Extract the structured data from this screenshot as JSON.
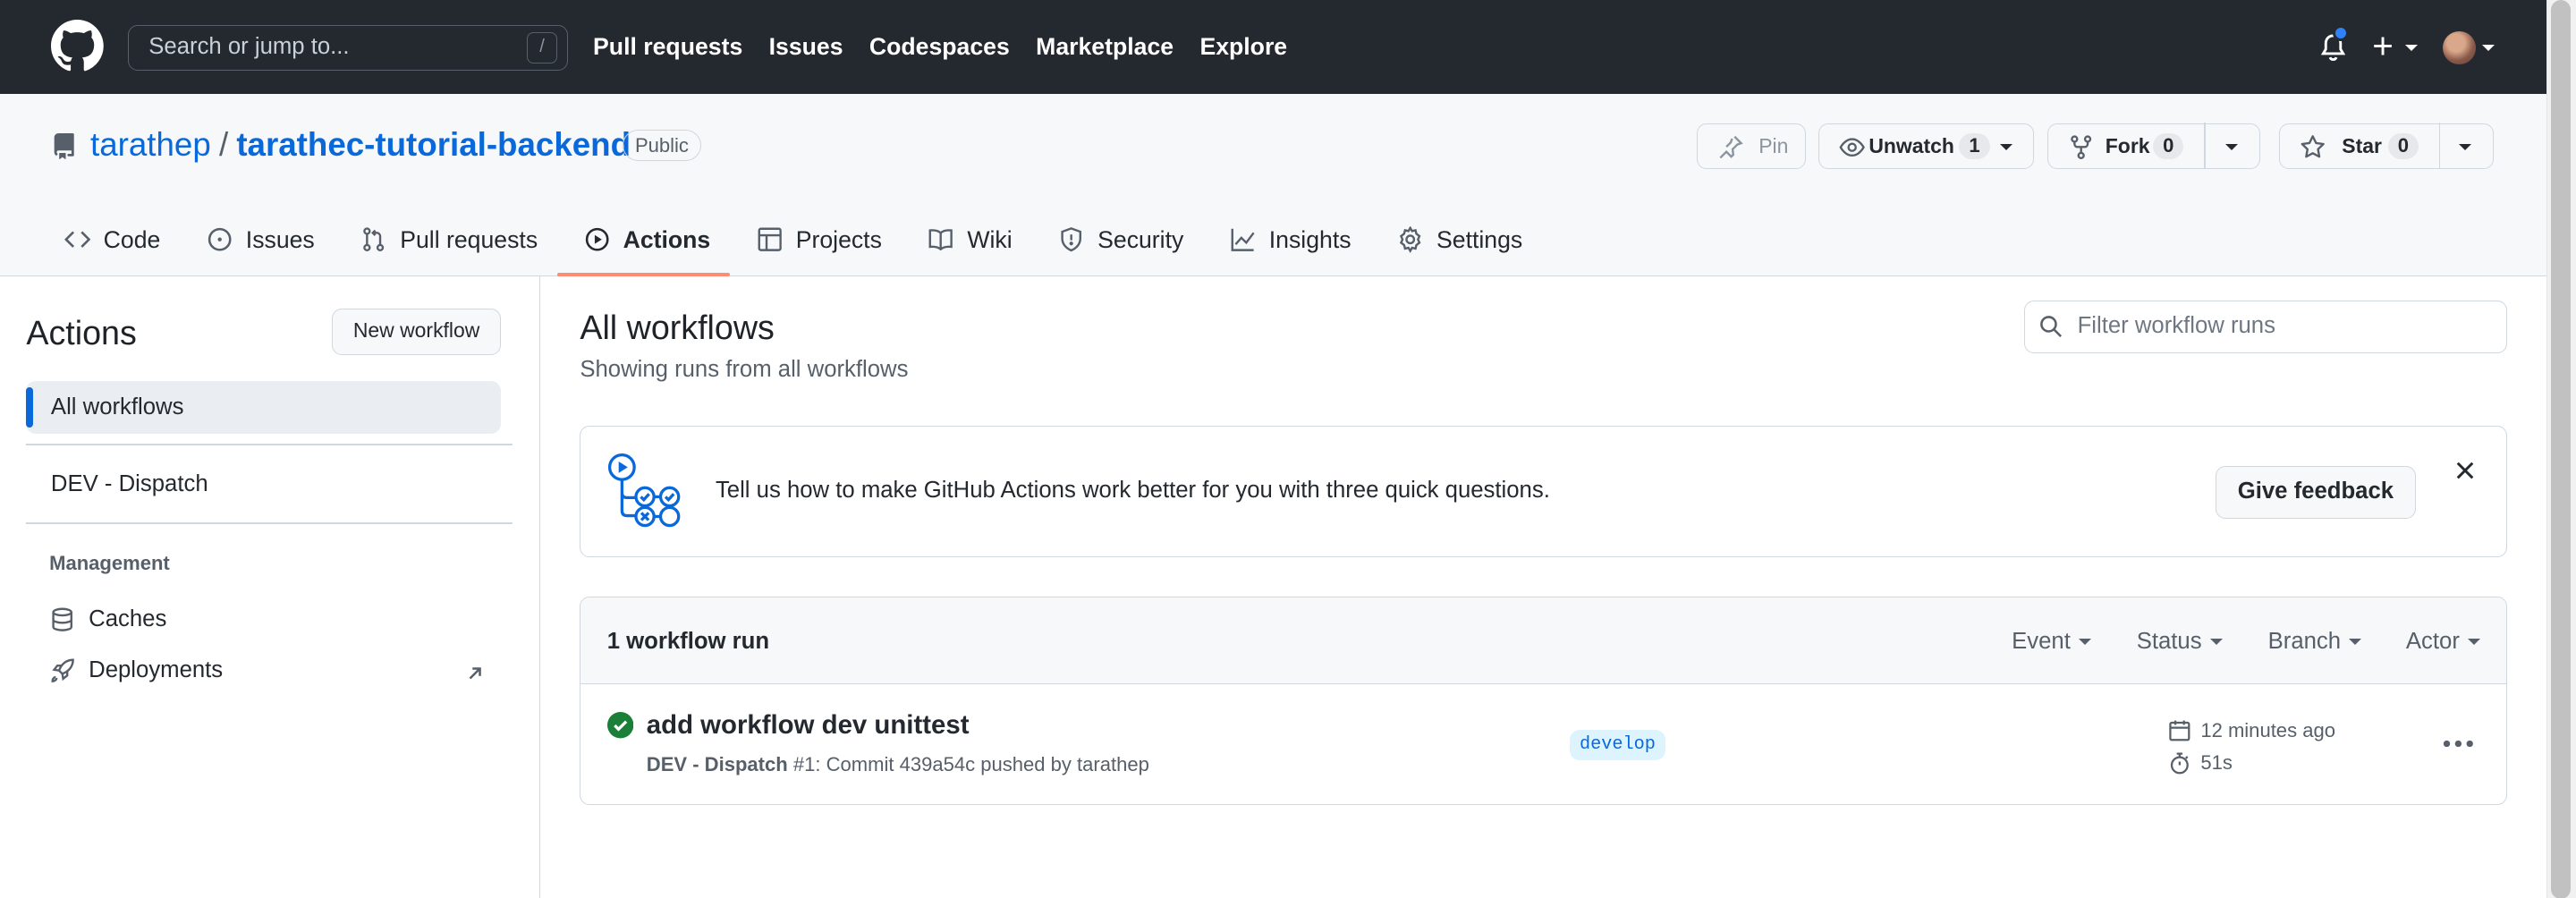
{
  "header": {
    "search_placeholder": "Search or jump to...",
    "search_shortcut": "/",
    "nav": [
      "Pull requests",
      "Issues",
      "Codespaces",
      "Marketplace",
      "Explore"
    ]
  },
  "repo": {
    "owner": "tarathep",
    "separator": "/",
    "name": "tarathec-tutorial-backend",
    "visibility": "Public",
    "actions": {
      "pin": "Pin",
      "unwatch": "Unwatch",
      "watch_count": "1",
      "fork": "Fork",
      "fork_count": "0",
      "star": "Star",
      "star_count": "0"
    },
    "tabs": [
      {
        "label": "Code",
        "icon": "code-icon"
      },
      {
        "label": "Issues",
        "icon": "issue-icon"
      },
      {
        "label": "Pull requests",
        "icon": "pull-request-icon"
      },
      {
        "label": "Actions",
        "icon": "play-icon",
        "selected": true
      },
      {
        "label": "Projects",
        "icon": "table-icon"
      },
      {
        "label": "Wiki",
        "icon": "book-icon"
      },
      {
        "label": "Security",
        "icon": "shield-icon"
      },
      {
        "label": "Insights",
        "icon": "graph-icon"
      },
      {
        "label": "Settings",
        "icon": "gear-icon"
      }
    ]
  },
  "sidebar": {
    "title": "Actions",
    "new_workflow": "New workflow",
    "items": [
      "All workflows",
      "DEV - Dispatch"
    ],
    "management_heading": "Management",
    "management": [
      {
        "label": "Caches",
        "icon": "database-icon"
      },
      {
        "label": "Deployments",
        "icon": "rocket-icon"
      }
    ]
  },
  "main": {
    "title": "All workflows",
    "subtitle": "Showing runs from all workflows",
    "filter_placeholder": "Filter workflow runs",
    "banner": {
      "text": "Tell us how to make GitHub Actions work better for you with three quick questions.",
      "button": "Give feedback"
    },
    "runs": {
      "count_label": "1 workflow run",
      "filters": [
        "Event",
        "Status",
        "Branch",
        "Actor"
      ],
      "items": [
        {
          "title": "add workflow dev unittest",
          "workflow": "DEV - Dispatch",
          "detail": "#1: Commit 439a54c pushed by tarathep",
          "branch": "develop",
          "time": "12 minutes ago",
          "duration": "51s",
          "status": "success"
        }
      ]
    }
  },
  "colors": {
    "accent": "#0969da",
    "header_bg": "#24292f",
    "selected_tab_underline": "#fd8c73",
    "success": "#1a7f37"
  }
}
